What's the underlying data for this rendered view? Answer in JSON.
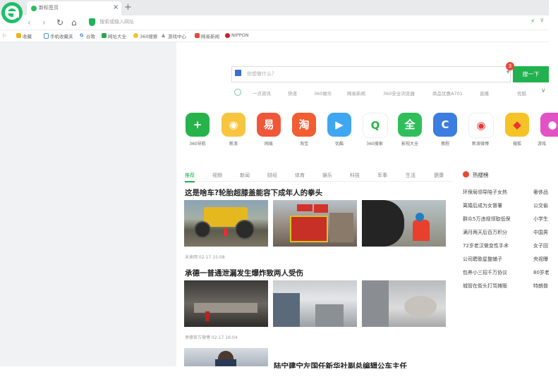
{
  "browser": {
    "tab_title": "新标签页",
    "tab_close": "×",
    "new_tab": "+",
    "address_placeholder": "搜索或输入网址",
    "bookmarks": [
      {
        "label": "收藏",
        "color": "#f1b417"
      },
      {
        "label": "手机收藏夹",
        "color": "#4a8fe0"
      },
      {
        "label": "谷歌",
        "color": "#3a7ce8"
      },
      {
        "label": "网址大全",
        "color": "#2aa84a"
      },
      {
        "label": "360搜索",
        "color": "#f5c130"
      },
      {
        "label": "游戏中心",
        "color": "#888888"
      },
      {
        "label": "网易新闻",
        "color": "#e84a3a"
      },
      {
        "label": "NIPPON",
        "color": "#c8202a"
      }
    ]
  },
  "search": {
    "placeholder": "你想做什么？",
    "button": "搜一下",
    "badge": "3",
    "hot_links": [
      "一点资讯",
      "快递",
      "360娱乐",
      "网易新闻",
      "360安全浏览器",
      "商品优惠A701",
      "直播",
      "优酷"
    ]
  },
  "apps": [
    {
      "name": "360导航",
      "color": "#27b34b",
      "glyph": "+"
    },
    {
      "name": "新浪",
      "color": "#f7c53f",
      "glyph": "◉"
    },
    {
      "name": "网易",
      "color": "#f0573a",
      "glyph": "易"
    },
    {
      "name": "淘宝",
      "color": "#f25d32",
      "glyph": "淘"
    },
    {
      "name": "优酷",
      "color": "#3fa6f2",
      "glyph": "▶"
    },
    {
      "name": "360搜索",
      "color": "#ffffff",
      "glyph": "Q"
    },
    {
      "name": "影视大全",
      "color": "#2fbf5a",
      "glyph": "全"
    },
    {
      "name": "携程",
      "color": "#3c7de0",
      "glyph": "C"
    },
    {
      "name": "新浪微博",
      "color": "#ffffff",
      "glyph": "◉"
    },
    {
      "name": "搜狐",
      "color": "#f6c327",
      "glyph": "◆"
    },
    {
      "name": "游戏",
      "color": "#e252c5",
      "glyph": "●"
    }
  ],
  "news": {
    "tabs": [
      "推荐",
      "视频",
      "新闻",
      "财经",
      "体育",
      "娱乐",
      "科技",
      "军事",
      "生活",
      "健康"
    ],
    "headline1": "这是啥车?轮胎超膝盖能容下成年人的拳头",
    "meta1": "未来网  02-17 15:08",
    "headline2": "承德一普通泄漏发生爆炸致两人受伤",
    "meta2": "承德官方微博  02-17 16:04",
    "headline3": "陆宁建宁左国任新华社副总编辑公车主任"
  },
  "hotlist": {
    "title": "热搜榜",
    "col1": [
      "环保局领导陪子女热",
      "离婚后成为女督署",
      "群众5万违规领取低保",
      "满月两天后百万积分",
      "72岁老汉做变性手术",
      "公司聘歌星整辅子",
      "包养小三招千万协议",
      "城管在街头打骂摊贩"
    ],
    "col2": [
      "奢侈品",
      "公交偷",
      "小学生",
      "中国男",
      "女子回",
      "央视曝",
      "80岁老",
      "特朗普"
    ]
  }
}
